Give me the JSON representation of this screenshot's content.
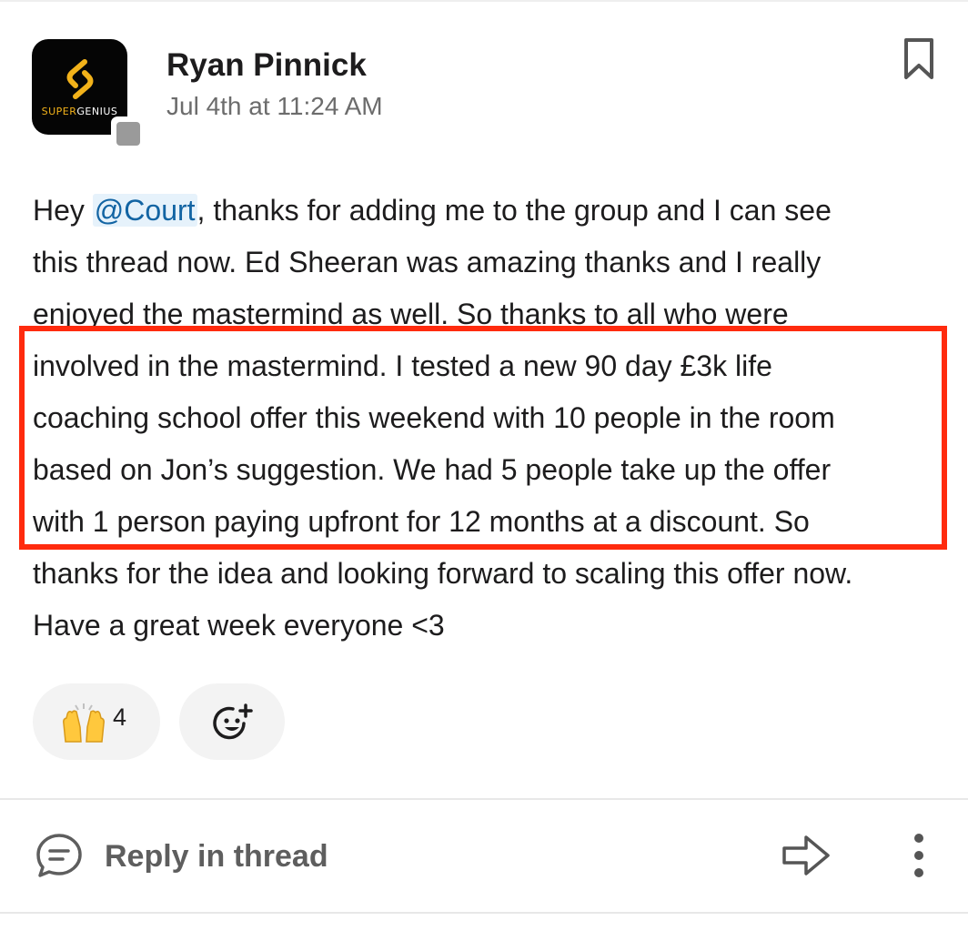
{
  "message": {
    "author": "Ryan Pinnick",
    "timestamp": "Jul 4th at 11:24 AM",
    "avatar_brand_a": "SUPER",
    "avatar_brand_b": "GENIUS",
    "lines": [
      {
        "pre": "Hey ",
        "mention": "@Court",
        "post": ", thanks for adding me to the group and I can see"
      },
      {
        "text": "this thread now.  Ed Sheeran was amazing thanks and I really"
      },
      {
        "text": "enjoyed the mastermind as well.  So thanks to all who were"
      },
      {
        "text": "involved in the mastermind.   I tested a new 90 day £3k life"
      },
      {
        "text": "coaching school offer this weekend with 10 people in the room"
      },
      {
        "text": "based on Jon’s suggestion.  We had 5 people take up the offer"
      },
      {
        "text": "with 1 person paying upfront for 12 months at a discount.  So"
      },
      {
        "text": "thanks for the idea and looking forward to scaling this offer now."
      },
      {
        "text": "Have a great week everyone <3"
      }
    ]
  },
  "reactions": [
    {
      "emoji": "raised-hands",
      "count": "4"
    }
  ],
  "actions": {
    "reply_label": "Reply in thread"
  },
  "colors": {
    "highlight_border": "#ff2b0e",
    "mention_bg": "#e6f2fb",
    "mention_text": "#1264a3",
    "brand_gold": "#f2b21a"
  }
}
